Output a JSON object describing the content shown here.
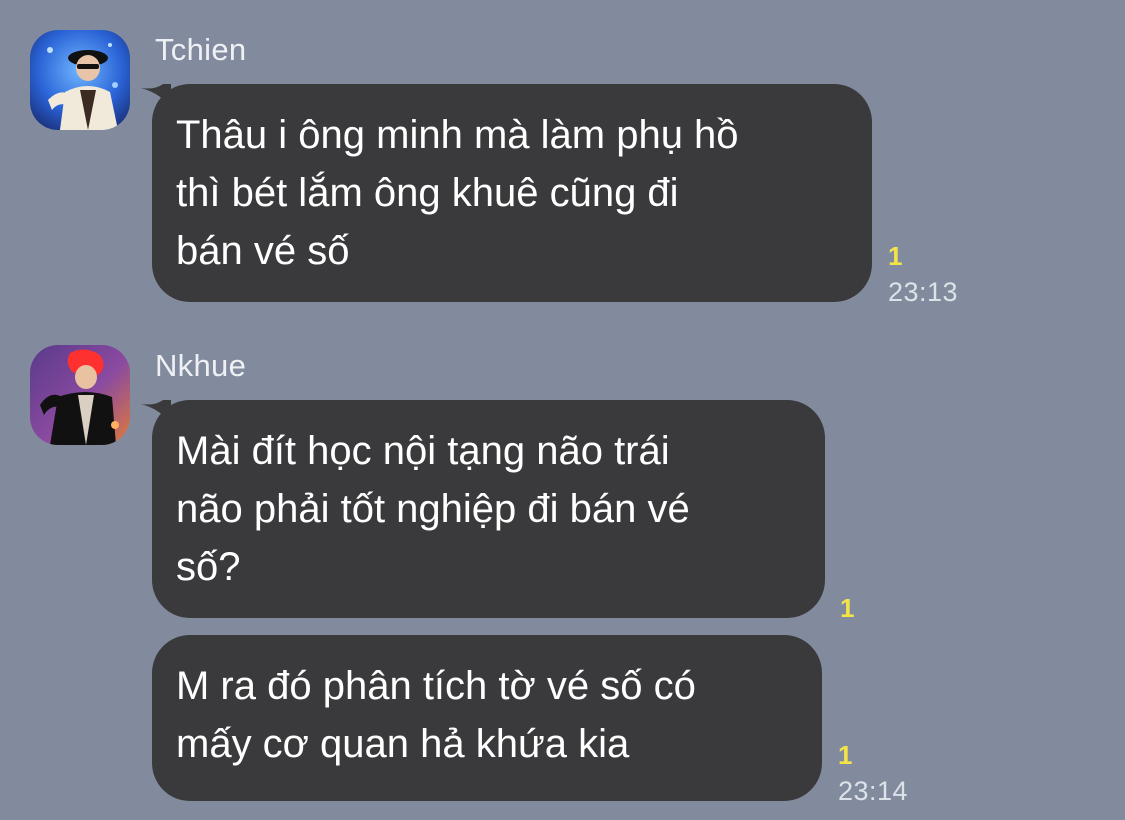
{
  "chat": {
    "messages": [
      {
        "sender": "Tchien",
        "avatar": "concert-performer-avatar",
        "text": "Thâu i ông minh mà làm phụ hồ\nthì bét lắm ông khuê cũng đi\nbán vé số",
        "read_count": "1",
        "time": "23:13"
      },
      {
        "sender": "Nkhue",
        "avatar": "red-hair-performer-avatar",
        "text": "Mài đít học nội tạng não trái\nnão phải tốt nghiệp đi bán vé\nsố?",
        "read_count": "1",
        "time": ""
      },
      {
        "sender": "",
        "avatar": "",
        "text": "M ra đó phân tích tờ vé số có\nmấy cơ quan hả khứa kia",
        "read_count": "1",
        "time": "23:14"
      }
    ]
  },
  "colors": {
    "background": "#828b9d",
    "bubble": "#3a3a3c",
    "bubble_text": "#ffffff",
    "read_count": "#f3e24a",
    "timestamp": "#dde1e8"
  }
}
